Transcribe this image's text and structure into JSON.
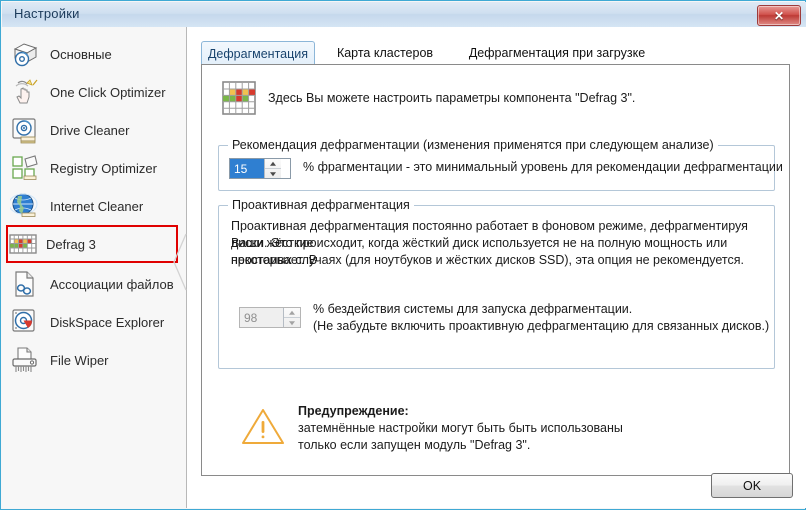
{
  "window": {
    "title": "Настройки",
    "close_label": "✕",
    "accent_border": "#3fa9d4",
    "selected_highlight": "#e00000"
  },
  "sidebar": {
    "items": [
      {
        "label": "Основные",
        "icon": "general-box-icon",
        "selected": false
      },
      {
        "label": "One Click Optimizer",
        "icon": "one-click-hand-icon",
        "selected": false
      },
      {
        "label": "Drive Cleaner",
        "icon": "drive-cleaner-icon",
        "selected": false
      },
      {
        "label": "Registry Optimizer",
        "icon": "registry-blocks-icon",
        "selected": false
      },
      {
        "label": "Internet Cleaner",
        "icon": "globe-icon",
        "selected": false
      },
      {
        "label": "Defrag 3",
        "icon": "defrag-grid-icon",
        "selected": true
      },
      {
        "label": "Ассоциации файлов",
        "icon": "file-link-icon",
        "selected": false
      },
      {
        "label": "DiskSpace Explorer",
        "icon": "diskspace-pie-icon",
        "selected": false
      },
      {
        "label": "File Wiper",
        "icon": "shredder-icon",
        "selected": false
      }
    ]
  },
  "tabs": [
    {
      "label": "Дефрагментация",
      "active": true
    },
    {
      "label": "Карта кластеров",
      "active": false
    },
    {
      "label": "Дефрагментация при  загрузке",
      "active": false
    }
  ],
  "main": {
    "header_text": "Здесь Вы можете настроить параметры компонента \"Defrag 3\".",
    "header_icon": "defrag-grid-icon",
    "recommendation": {
      "legend": "Рекомендация дефрагментации (изменения применятся при следующем анализе)",
      "value": "15",
      "description": "% фрагментации - это минимальный уровень для рекомендации дефрагментации"
    },
    "proactive": {
      "legend": "Проактивная дефрагментация",
      "paragraph_line1": "Проактивная дефрагментация постоянно работает в фоновом режиме, дефрагментируя Ваши жёсткие",
      "paragraph_line2": "диски. Это происходит, когда жёсткий диск используется не на полную мощность или простаивает. В",
      "paragraph_line3": "некоторых случаях (для ноутбуков и жёстких дисков SSD), эта опция не рекомендуется.",
      "value": "98",
      "desc_line1": "% бездействия системы для запуска дефрагментации.",
      "desc_line2": "(Не забудьте включить проактивную дефрагментацию для связанных дисков.)"
    },
    "warning": {
      "icon": "warning-triangle-icon",
      "title": "Предупреждение:",
      "line1": "затемнённые настройки могут быть быть использованы",
      "line2": "только если запущен модуль \"Defrag 3\"."
    }
  },
  "footer": {
    "ok_label": "OK"
  }
}
